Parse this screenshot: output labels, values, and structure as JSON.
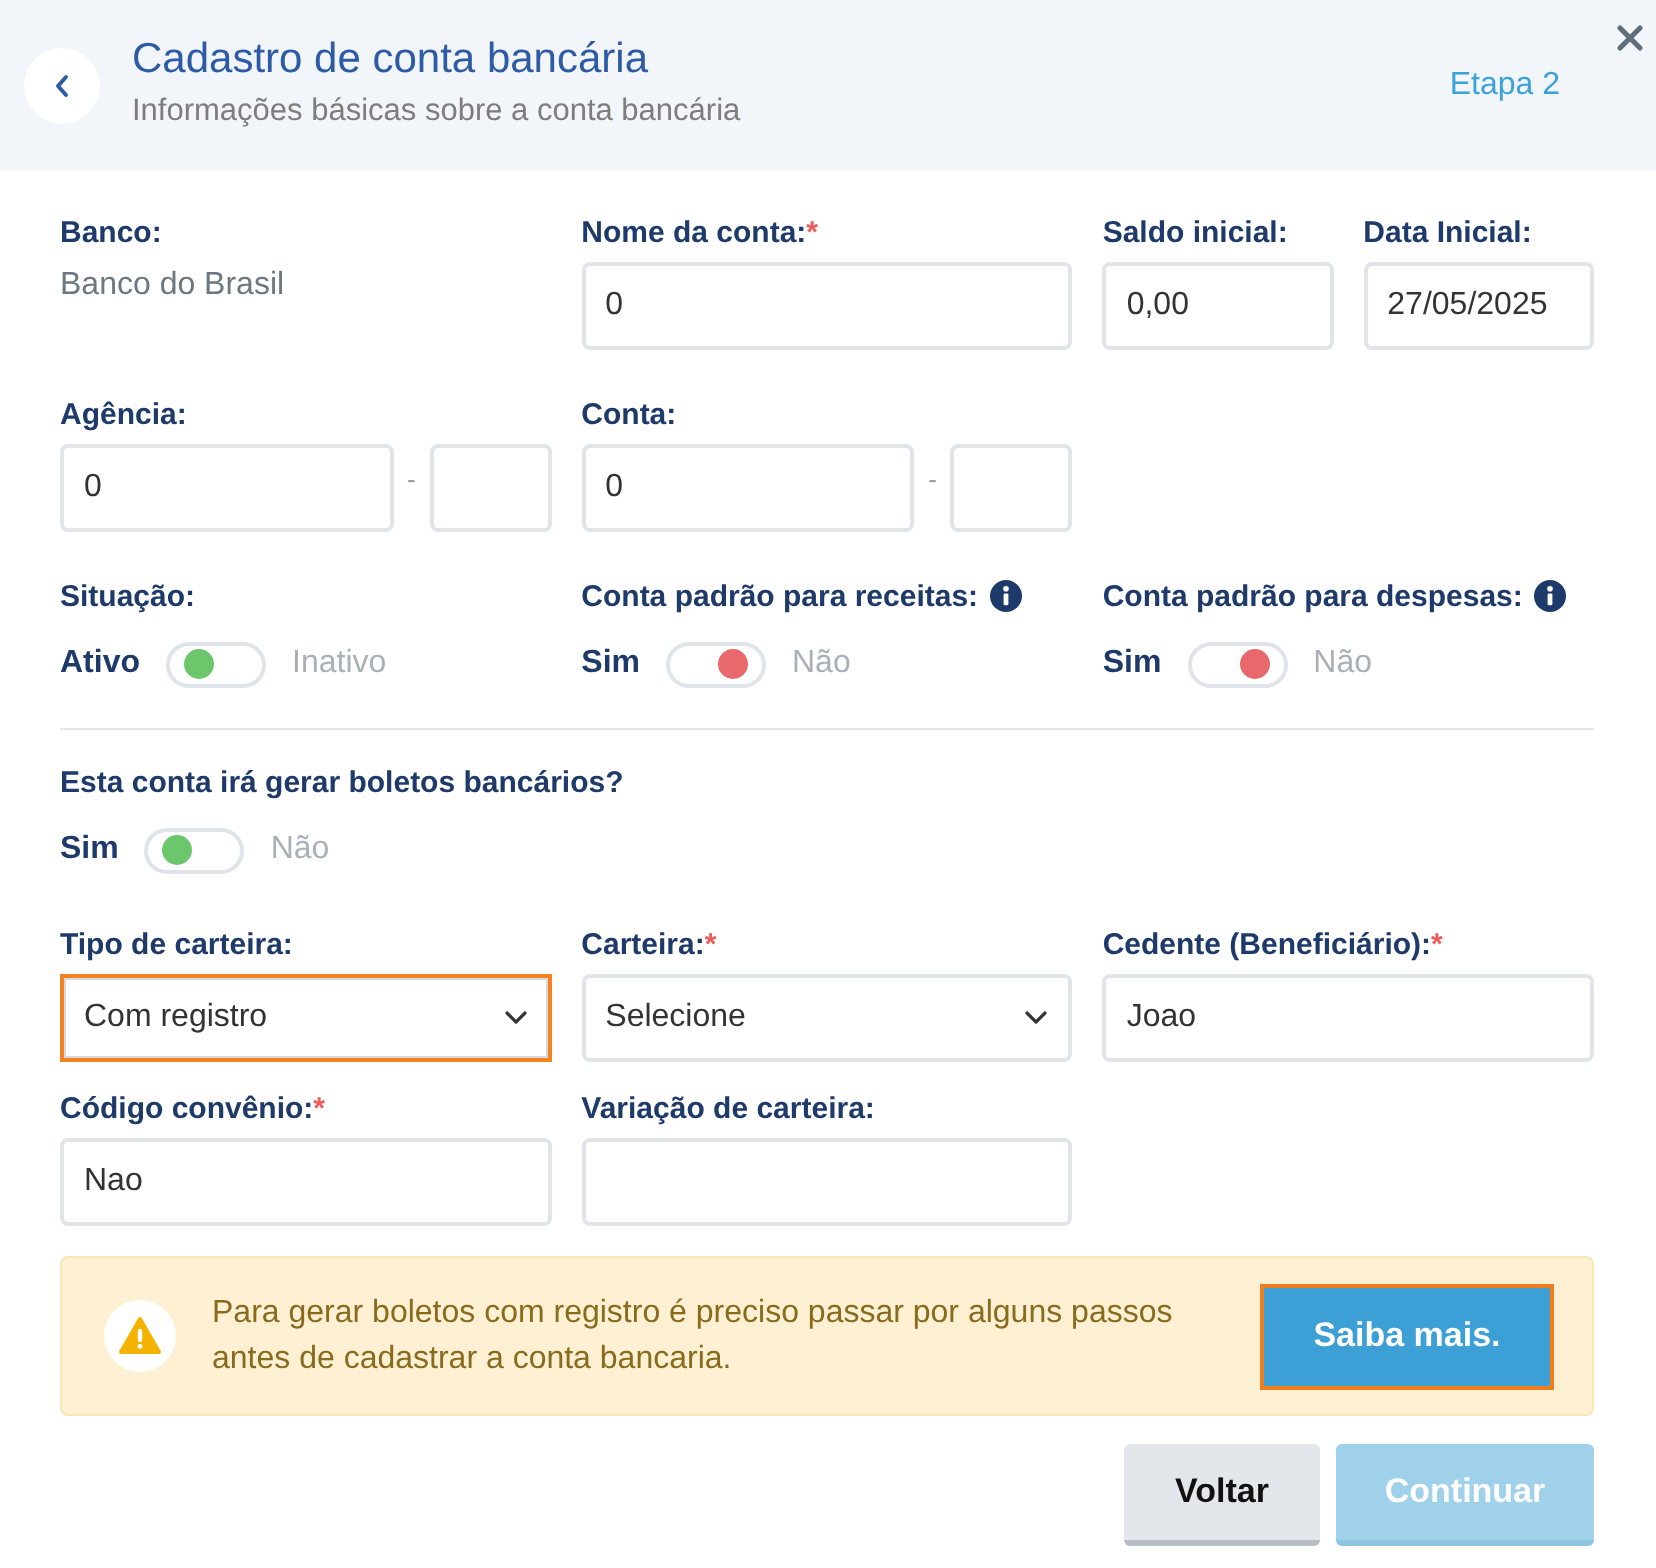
{
  "header": {
    "title": "Cadastro de conta bancária",
    "subtitle": "Informações básicas sobre a conta bancária",
    "step": "Etapa 2"
  },
  "account": {
    "rows": [
      {
        "fields": [
          {
            "kind": "static",
            "label": "Banco:",
            "value": "Banco do Brasil"
          },
          {
            "kind": "text",
            "label": "Nome da conta:",
            "required_mark": "*",
            "value": "0"
          },
          {
            "kind": "text",
            "label": "Saldo inicial:",
            "value": "0,00"
          },
          {
            "kind": "text",
            "label": "Data Inicial:",
            "value": "27/05/2025"
          }
        ]
      },
      {
        "fields": [
          {
            "kind": "split",
            "label": "Agência:",
            "value": "0",
            "separator": "-"
          },
          {
            "kind": "split",
            "label": "Conta:",
            "value": "0",
            "separator": "-"
          }
        ]
      },
      {
        "fields": [
          {
            "kind": "toggle",
            "label": "Situação:",
            "info": false,
            "option_on": "Ativo",
            "option_off": "Inativo",
            "on": false
          },
          {
            "kind": "toggle",
            "label": "Conta padrão para receitas:",
            "info": true,
            "option_on": "Sim",
            "option_off": "Não",
            "on": true
          },
          {
            "kind": "toggle",
            "label": "Conta padrão para despesas:",
            "info": true,
            "option_on": "Sim",
            "option_off": "Não",
            "on": true
          }
        ]
      }
    ]
  },
  "boleto": {
    "rows": [
      {
        "fields": [
          {
            "kind": "toggle",
            "label": "Esta conta irá gerar boletos bancários?",
            "info": false,
            "option_on": "Sim",
            "option_off": "Não",
            "on": false
          }
        ]
      },
      {
        "fields": [
          {
            "kind": "select",
            "label": "Tipo de carteira:",
            "value": "Com registro",
            "highlighted": true
          },
          {
            "kind": "select",
            "label": "Carteira:",
            "required_mark": "*",
            "value": "Selecione",
            "highlighted": false
          },
          {
            "kind": "text",
            "label": "Cedente (Beneficiário):",
            "required_mark": "*",
            "value": "Joao"
          }
        ]
      },
      {
        "fields": [
          {
            "kind": "text",
            "label": "Código convênio:",
            "required_mark": "*",
            "value": "Nao"
          },
          {
            "kind": "text",
            "label": "Variação de carteira:"
          }
        ]
      }
    ]
  },
  "alert": {
    "text": "Para gerar boletos com registro é preciso passar por alguns passos antes de cadastrar a conta bancaria.",
    "button": {
      "label": "Saiba mais.",
      "highlighted": true
    }
  },
  "actions": [
    {
      "kind": "secondary",
      "label": "Voltar",
      "disabled": false
    },
    {
      "kind": "primary",
      "label": "Continuar",
      "disabled": true
    }
  ]
}
